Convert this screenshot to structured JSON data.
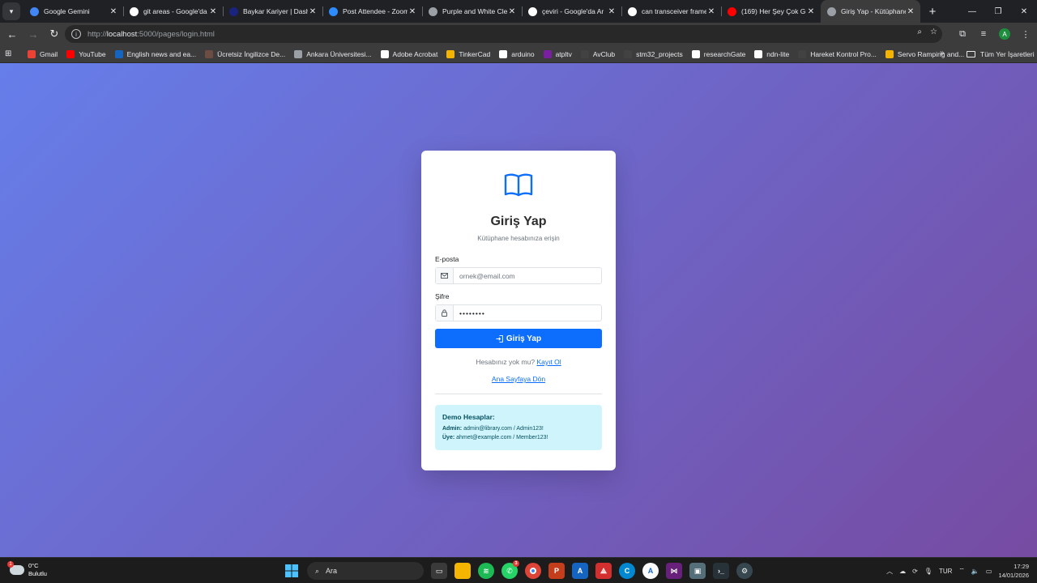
{
  "browser": {
    "tabs": [
      {
        "title": "Google Gemini",
        "favicon_color": "#4285f4",
        "active": false
      },
      {
        "title": "git areas - Google'da",
        "favicon_color": "#ffffff",
        "active": false
      },
      {
        "title": "Baykar Kariyer | Dash",
        "favicon_color": "#1a237e",
        "active": false
      },
      {
        "title": "Post Attendee - Zoom",
        "favicon_color": "#2d8cff",
        "active": false
      },
      {
        "title": "Purple and White Cle",
        "favicon_color": "#9aa0a6",
        "active": false
      },
      {
        "title": "çeviri - Google'da Ar",
        "favicon_color": "#ffffff",
        "active": false
      },
      {
        "title": "can transceiver frame",
        "favicon_color": "#ffffff",
        "active": false
      },
      {
        "title": "(169) Her Şey Çok Gü",
        "favicon_color": "#ff0000",
        "active": false
      },
      {
        "title": "Giriş Yap - Kütüphane",
        "favicon_color": "#9aa0a6",
        "active": true
      }
    ],
    "new_tab_label": "+",
    "address": {
      "prefix": "http://",
      "host": "localhost",
      "rest": ":5000/pages/login.html"
    },
    "bookmarks": [
      {
        "label": "Gmail",
        "color": "#ea4335"
      },
      {
        "label": "YouTube",
        "color": "#ff0000"
      },
      {
        "label": "English news and ea...",
        "color": "#1565c0"
      },
      {
        "label": "Ücretsiz İngilizce De...",
        "color": "#6d4c41"
      },
      {
        "label": "Ankara Üniversitesi...",
        "color": "#9aa0a6"
      },
      {
        "label": "Adobe Acrobat",
        "color": "#ffffff"
      },
      {
        "label": "TinkerCad",
        "color": "#f4b400"
      },
      {
        "label": "arduino",
        "color": "#ffffff"
      },
      {
        "label": "atpltv",
        "color": "#7b1fa2"
      },
      {
        "label": "AvClub",
        "color": "#424242"
      },
      {
        "label": "stm32_projects",
        "color": "#424242"
      },
      {
        "label": "researchGate",
        "color": "#ffffff"
      },
      {
        "label": "ndn-lite",
        "color": "#ffffff"
      },
      {
        "label": "Hareket Kontrol Pro...",
        "color": "#424242"
      },
      {
        "label": "Servo Ramping and...",
        "color": "#f4b400"
      }
    ],
    "bookmarks_more": "»",
    "all_bookmarks": "Tüm Yer İşaretleri",
    "profile_initial": "A"
  },
  "page": {
    "title": "Giriş Yap",
    "subtitle": "Kütüphane hesabınıza erişin",
    "email_label": "E-posta",
    "email_placeholder": "ornek@email.com",
    "password_label": "Şifre",
    "password_value": "••••••••",
    "login_button": "Giriş Yap",
    "no_account_text": "Hesabınız yok mu?",
    "register_link": "Kayıt Ol",
    "home_link": "Ana Sayfaya Dön",
    "demo": {
      "title": "Demo Hesaplar:",
      "admin_label": "Admin:",
      "admin_value": "admin@library.com / Admin123!",
      "member_label": "Üye:",
      "member_value": "ahmet@example.com / Member123!"
    },
    "accent_color": "#0d6efd",
    "gradient": [
      "#667eea",
      "#764ba2"
    ]
  },
  "taskbar": {
    "weather_temp": "0°C",
    "weather_desc": "Bulutlu",
    "weather_badge": "1",
    "search_placeholder": "Ara",
    "whatsapp_badge": "3",
    "language": "TUR",
    "time": "17:29",
    "date": "14/01/2026"
  }
}
